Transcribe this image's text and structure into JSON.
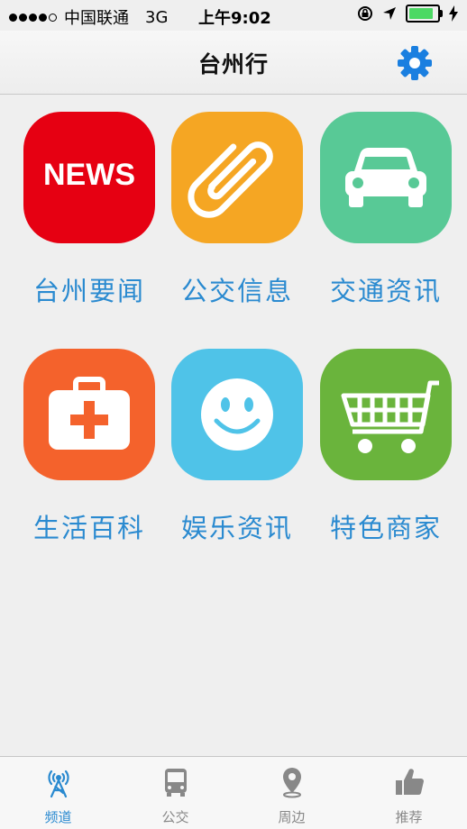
{
  "status": {
    "carrier": "中国联通",
    "network": "3G",
    "time": "上午9:02"
  },
  "nav": {
    "title": "台州行",
    "settings_icon": "gear-icon"
  },
  "tiles": [
    {
      "label": "台州要闻",
      "icon": "news-icon",
      "icon_text": "NEWS",
      "color": "#e60012"
    },
    {
      "label": "公交信息",
      "icon": "paperclip-icon",
      "color": "#f5a623"
    },
    {
      "label": "交通资讯",
      "icon": "car-icon",
      "color": "#58c996"
    },
    {
      "label": "生活百科",
      "icon": "first-aid-kit-icon",
      "color": "#f4622c"
    },
    {
      "label": "娱乐资讯",
      "icon": "smiley-face-icon",
      "color": "#4fc3e8"
    },
    {
      "label": "特色商家",
      "icon": "shopping-cart-icon",
      "color": "#6ab43c"
    }
  ],
  "tabs": [
    {
      "label": "频道",
      "icon": "broadcast-tower-icon",
      "active": true
    },
    {
      "label": "公交",
      "icon": "bus-icon",
      "active": false
    },
    {
      "label": "周边",
      "icon": "map-pin-icon",
      "active": false
    },
    {
      "label": "推荐",
      "icon": "thumbs-up-icon",
      "active": false
    }
  ],
  "colors": {
    "accent": "#2a8ad0",
    "tab_inactive": "#888888"
  }
}
